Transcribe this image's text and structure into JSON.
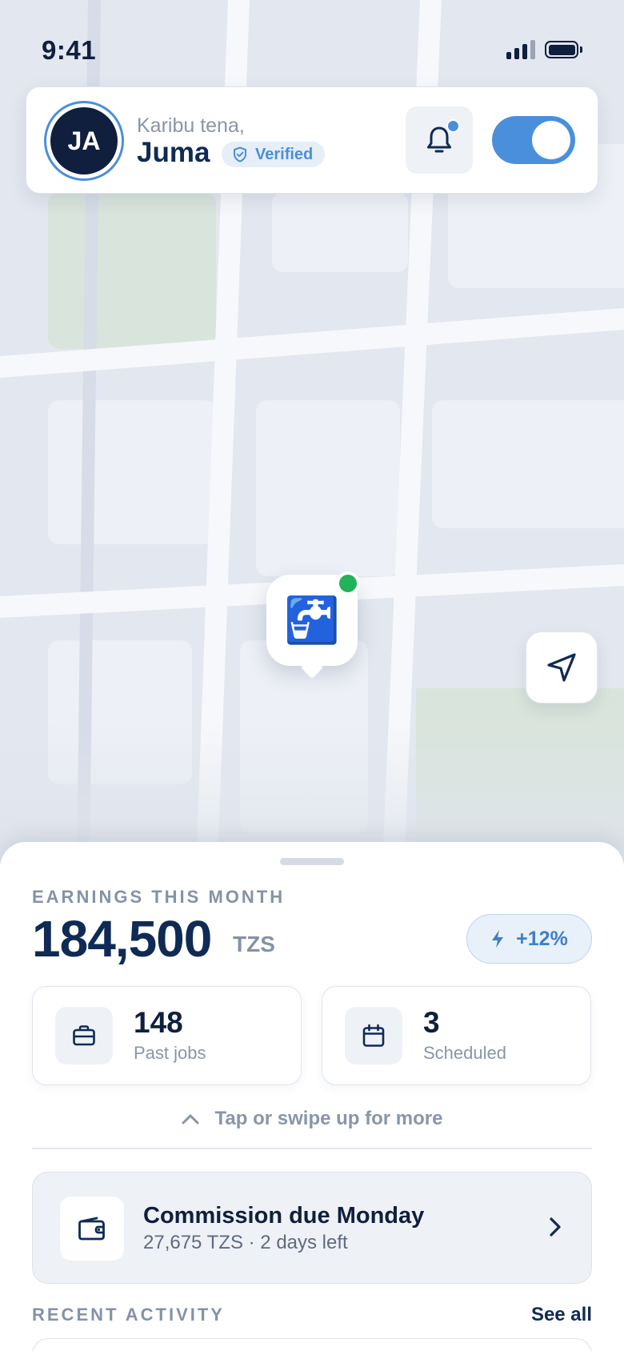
{
  "status_bar": {
    "time": "9:41"
  },
  "header": {
    "avatar_initials": "JA",
    "greeting": "Karibu tena,",
    "name": "Juma",
    "verified_label": "Verified",
    "notification_unread": true,
    "online_toggle_on": true
  },
  "map": {
    "worker_pin_emoji": "🚰",
    "worker_pin_icon": "faucet-icon",
    "online_status_color": "#22b25a",
    "locate_icon": "navigation-arrow-icon"
  },
  "sheet": {
    "earnings_label": "EARNINGS THIS MONTH",
    "earnings_amount": "184,500",
    "earnings_currency": "TZS",
    "growth": "+12%",
    "stats": [
      {
        "value": "148",
        "label": "Past jobs",
        "icon": "briefcase-icon"
      },
      {
        "value": "3",
        "label": "Scheduled",
        "icon": "calendar-icon"
      }
    ],
    "swipe_hint": "Tap or swipe up for more",
    "commission": {
      "title": "Commission due Monday",
      "subtitle": "27,675 TZS · 2 days left",
      "icon": "wallet-icon"
    },
    "recent_label": "RECENT ACTIVITY",
    "see_all": "See all"
  },
  "colors": {
    "accent": "#4a8fdc",
    "navy": "#0f2a55",
    "online": "#22b25a"
  }
}
